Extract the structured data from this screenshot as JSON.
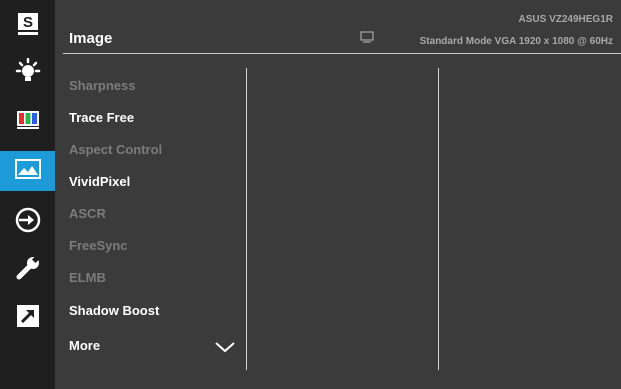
{
  "header": {
    "title": "Image",
    "model": "ASUS  VZ249HEG1R",
    "mode_line": "Standard Mode VGA  1920 x 1080 @ 60Hz",
    "monitor_icon": "monitor-icon"
  },
  "sidebar": {
    "items": [
      {
        "name": "splendid-icon",
        "active": false
      },
      {
        "name": "blue-light-icon",
        "active": false
      },
      {
        "name": "color-icon",
        "active": false
      },
      {
        "name": "image-icon",
        "active": true
      },
      {
        "name": "input-select-icon",
        "active": false
      },
      {
        "name": "system-setup-icon",
        "active": false
      },
      {
        "name": "shortcut-icon",
        "active": false
      }
    ]
  },
  "menu": {
    "items": [
      {
        "label": "Sharpness",
        "enabled": false
      },
      {
        "label": "Trace Free",
        "enabled": true
      },
      {
        "label": "Aspect Control",
        "enabled": false
      },
      {
        "label": "VividPixel",
        "enabled": true
      },
      {
        "label": "ASCR",
        "enabled": false
      },
      {
        "label": "FreeSync",
        "enabled": false
      },
      {
        "label": "ELMB",
        "enabled": false
      },
      {
        "label": "Shadow Boost",
        "enabled": true
      },
      {
        "label": "More",
        "enabled": true
      }
    ],
    "more_icon": "chevron-down-icon"
  },
  "colors": {
    "panel": "#3b3b3b",
    "sidebar": "#1f1f1f",
    "accent": "#1c9bd8",
    "text_enabled": "#ffffff",
    "text_disabled": "#7c7c7c"
  }
}
